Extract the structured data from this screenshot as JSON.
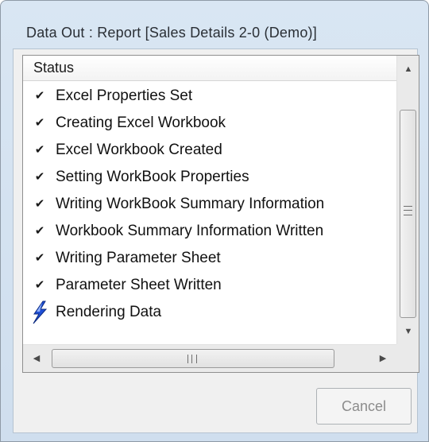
{
  "window": {
    "title": "Data Out : Report [Sales Details 2-0 (Demo)]"
  },
  "status_list": {
    "column_header": "Status",
    "items": [
      {
        "icon": "checkmark-icon",
        "label": "Excel Properties Set"
      },
      {
        "icon": "checkmark-icon",
        "label": "Creating Excel Workbook"
      },
      {
        "icon": "checkmark-icon",
        "label": "Excel Workbook Created"
      },
      {
        "icon": "checkmark-icon",
        "label": "Setting WorkBook Properties"
      },
      {
        "icon": "checkmark-icon",
        "label": "Writing WorkBook Summary Information"
      },
      {
        "icon": "checkmark-icon",
        "label": "Workbook Summary Information Written"
      },
      {
        "icon": "checkmark-icon",
        "label": "Writing Parameter Sheet"
      },
      {
        "icon": "checkmark-icon",
        "label": "Parameter Sheet Written"
      },
      {
        "icon": "lightning-bolt-icon",
        "label": "Rendering Data"
      }
    ]
  },
  "buttons": {
    "cancel_label": "Cancel",
    "cancel_enabled": false
  },
  "colors": {
    "window_frame": "#d9e6f3",
    "bolt_blue": "#1f4fd6",
    "disabled_text": "#8c8c8c"
  }
}
